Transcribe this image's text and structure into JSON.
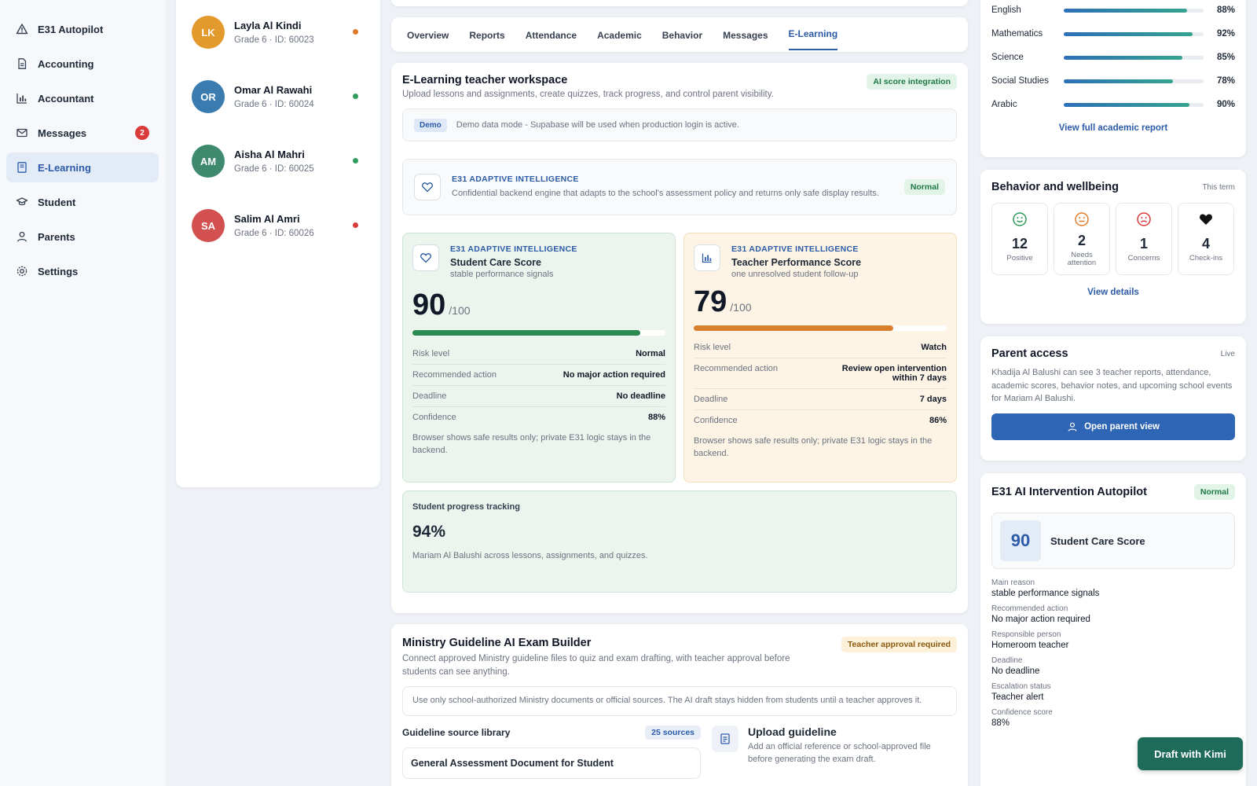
{
  "sidebar": {
    "items": [
      {
        "label": "E31 Autopilot",
        "icon": "alert-triangle-icon"
      },
      {
        "label": "Accounting",
        "icon": "document-icon"
      },
      {
        "label": "Accountant",
        "icon": "bar-chart-icon"
      },
      {
        "label": "Messages",
        "icon": "mail-icon",
        "badge": "2"
      },
      {
        "label": "E-Learning",
        "icon": "book-icon"
      },
      {
        "label": "Student",
        "icon": "graduation-cap-icon"
      },
      {
        "label": "Parents",
        "icon": "user-icon"
      },
      {
        "label": "Settings",
        "icon": "gear-icon"
      }
    ],
    "active": "E-Learning"
  },
  "students": [
    {
      "initials": "LK",
      "name": "Layla Al Kindi",
      "sub": "Grade 6 · ID: 60023",
      "color": "#e39a2c",
      "status": "#e07b2a"
    },
    {
      "initials": "OR",
      "name": "Omar Al Rawahi",
      "sub": "Grade 6 · ID: 60024",
      "color": "#3a7bb0",
      "status": "#2e9c5a"
    },
    {
      "initials": "AM",
      "name": "Aisha Al Mahri",
      "sub": "Grade 6 · ID: 60025",
      "color": "#3f8a6e",
      "status": "#2e9c5a"
    },
    {
      "initials": "SA",
      "name": "Salim Al Amri",
      "sub": "Grade 6 · ID: 60026",
      "color": "#d2504f",
      "status": "#dc3b3b"
    }
  ],
  "tabs": [
    "Overview",
    "Reports",
    "Attendance",
    "Academic",
    "Behavior",
    "Messages",
    "E-Learning"
  ],
  "active_tab": "E-Learning",
  "workspace": {
    "title": "E-Learning teacher workspace",
    "subtitle": "Upload lessons and assignments, create quizzes, track progress, and control parent visibility.",
    "badge": "AI score integration",
    "demo_tag": "Demo",
    "demo_text": "Demo data mode - Supabase will be used when production login is active.",
    "engine": {
      "eyebrow": "E31 ADAPTIVE INTELLIGENCE",
      "text": "Confidential backend engine that adapts to the school's assessment policy and returns only safe display results.",
      "badge": "Normal"
    },
    "care": {
      "eyebrow": "E31 ADAPTIVE INTELLIGENCE",
      "title": "Student Care Score",
      "sub": "stable performance signals",
      "score": "90",
      "max": "/100",
      "progress": 0.9,
      "rows": [
        {
          "k": "Risk level",
          "v": "Normal"
        },
        {
          "k": "Recommended action",
          "v": "No major action required"
        },
        {
          "k": "Deadline",
          "v": "No deadline"
        },
        {
          "k": "Confidence",
          "v": "88%"
        }
      ],
      "note": "Browser shows safe results only; private E31 logic stays in the backend."
    },
    "teacher": {
      "eyebrow": "E31 ADAPTIVE INTELLIGENCE",
      "title": "Teacher Performance Score",
      "sub": "one unresolved student follow-up",
      "score": "79",
      "max": "/100",
      "progress": 0.79,
      "rows": [
        {
          "k": "Risk level",
          "v": "Watch"
        },
        {
          "k": "Recommended action",
          "v": "Review open intervention within 7 days"
        },
        {
          "k": "Deadline",
          "v": "7 days"
        },
        {
          "k": "Confidence",
          "v": "86%"
        }
      ],
      "note": "Browser shows safe results only; private E31 logic stays in the backend."
    },
    "progress": {
      "title": "Student progress tracking",
      "value": "94%",
      "text": "Mariam Al Balushi across lessons, assignments, and quizzes."
    }
  },
  "exam": {
    "title": "Ministry Guideline AI Exam Builder",
    "subtitle": "Connect approved Ministry guideline files to quiz and exam drafting, with teacher approval before students can see anything.",
    "badge": "Teacher approval required",
    "notice": "Use only school-authorized Ministry documents or official sources. The AI draft stays hidden from students until a teacher approves it.",
    "library_title": "Guideline source library",
    "library_badge": "25 sources",
    "library_first": "General Assessment Document for Student",
    "upload_title": "Upload guideline",
    "upload_text": "Add an official reference or school-approved file before generating the exam draft."
  },
  "subjects": [
    {
      "name": "English",
      "pct": 88,
      "label": "88%"
    },
    {
      "name": "Mathematics",
      "pct": 92,
      "label": "92%"
    },
    {
      "name": "Science",
      "pct": 85,
      "label": "85%"
    },
    {
      "name": "Social Studies",
      "pct": 78,
      "label": "78%"
    },
    {
      "name": "Arabic",
      "pct": 90,
      "label": "90%"
    }
  ],
  "academic_link": "View full academic report",
  "behavior": {
    "title": "Behavior and wellbeing",
    "period": "This term",
    "stats": [
      {
        "n": "12",
        "l": "Positive",
        "icon": "smile-icon",
        "color": "#2e9c5a"
      },
      {
        "n": "2",
        "l": "Needs attention",
        "icon": "neutral-face-icon",
        "color": "#e07b2a"
      },
      {
        "n": "1",
        "l": "Concerns",
        "icon": "sad-face-icon",
        "color": "#dc3b3b"
      },
      {
        "n": "4",
        "l": "Check-ins",
        "icon": "heart-icon",
        "color": "#111111"
      }
    ],
    "link": "View details"
  },
  "parent": {
    "title": "Parent access",
    "status": "Live",
    "text": "Khadija Al Balushi can see 3 teacher reports, attendance, academic scores, behavior notes, and upcoming school events for Mariam Al Balushi.",
    "button": "Open parent view"
  },
  "autopilot": {
    "title": "E31 AI Intervention Autopilot",
    "badge": "Normal",
    "score": "90",
    "score_label": "Student Care Score",
    "fields": [
      {
        "k": "Main reason",
        "v": "stable performance signals"
      },
      {
        "k": "Recommended action",
        "v": "No major action required"
      },
      {
        "k": "Responsible person",
        "v": "Homeroom teacher"
      },
      {
        "k": "Deadline",
        "v": "No deadline"
      },
      {
        "k": "Escalation status",
        "v": "Teacher alert"
      },
      {
        "k": "Confidence score",
        "v": "88%"
      }
    ]
  },
  "fab": "Draft with Kimi"
}
